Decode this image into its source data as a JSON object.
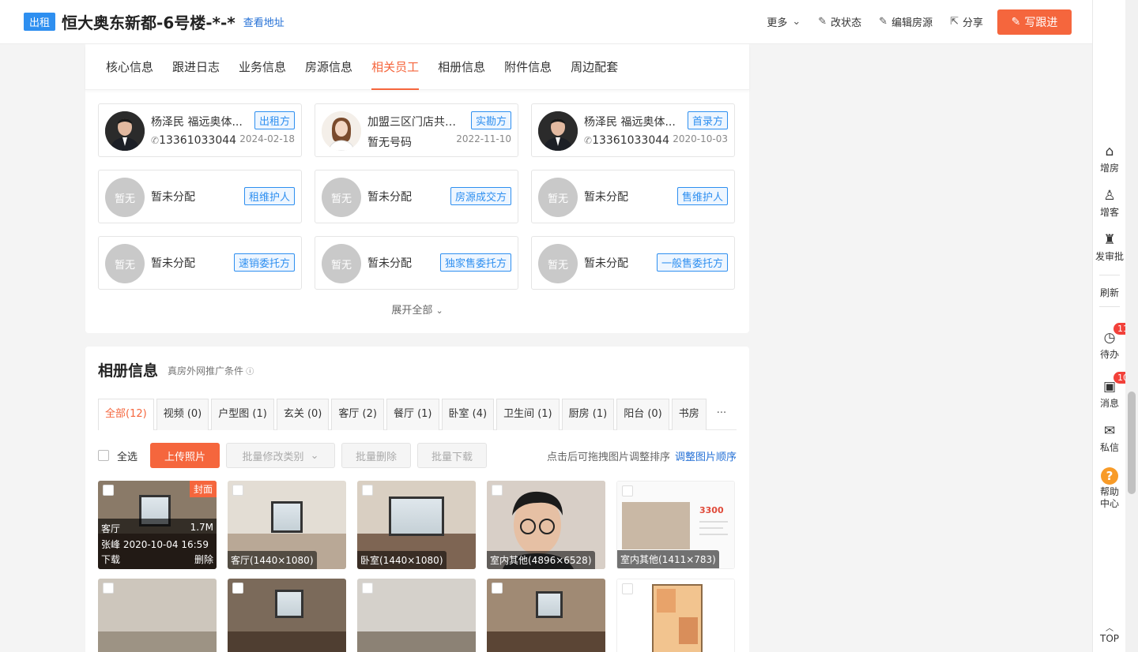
{
  "header": {
    "tag": "出租",
    "title": "恒大奥东新都-6号楼-*-*",
    "address_link": "查看地址",
    "actions": [
      {
        "label": "更多",
        "icon": "chevron-down-icon"
      },
      {
        "label": "改状态",
        "icon": "edit-icon"
      },
      {
        "label": "编辑房源",
        "icon": "edit-icon"
      },
      {
        "label": "分享",
        "icon": "share-icon"
      }
    ],
    "primary_button": "写跟进"
  },
  "tabs": [
    "核心信息",
    "跟进日志",
    "业务信息",
    "房源信息",
    "相关员工",
    "相册信息",
    "附件信息",
    "周边配套"
  ],
  "active_tab": "相关员工",
  "staff": [
    {
      "name": "杨泽民 福远奥体...",
      "phone": "13361033044",
      "date": "2024-02-18",
      "role": "出租方",
      "avatar": "male-photo"
    },
    {
      "name": "加盟三区门店共享...",
      "phone": "暂无号码",
      "date": "2022-11-10",
      "role": "实勘方",
      "avatar": "female-photo"
    },
    {
      "name": "杨泽民 福远奥体...",
      "phone": "13361033044",
      "date": "2020-10-03",
      "role": "首录方",
      "avatar": "male-photo"
    },
    {
      "name": "暂未分配",
      "role": "租维护人",
      "avatar": "暂无"
    },
    {
      "name": "暂未分配",
      "role": "房源成交方",
      "avatar": "暂无"
    },
    {
      "name": "暂未分配",
      "role": "售维护人",
      "avatar": "暂无"
    },
    {
      "name": "暂未分配",
      "role": "速销委托方",
      "avatar": "暂无"
    },
    {
      "name": "暂未分配",
      "role": "独家售委托方",
      "avatar": "暂无"
    },
    {
      "name": "暂未分配",
      "role": "一般售委托方",
      "avatar": "暂无"
    }
  ],
  "expand_label": "展开全部",
  "album": {
    "title": "相册信息",
    "subtitle": "真房外网推广条件",
    "categories": [
      "全部(12)",
      "视频 (0)",
      "户型图 (1)",
      "玄关 (0)",
      "客厅 (2)",
      "餐厅 (1)",
      "卧室 (4)",
      "卫生间 (1)",
      "厨房 (1)",
      "阳台 (0)",
      "书房"
    ],
    "more": "···",
    "select_all": "全选",
    "upload": "上传照片",
    "batch_category": "批量修改类别",
    "batch_delete": "批量删除",
    "batch_download": "批量下载",
    "hint": "点击后可拖拽图片调整排序",
    "hint_link": "调整图片顺序",
    "cover_photo": {
      "badge": "封面",
      "category": "客厅",
      "size": "1.7M",
      "author": "张峰 2020-10-04 16:59",
      "download": "下载",
      "delete": "删除"
    },
    "photos": [
      "客厅(1440×1080)",
      "卧室(1440×1080)",
      "室内其他(4896×6528)",
      "室内其他(1411×783)"
    ]
  },
  "sidebar": [
    {
      "label": "增房",
      "icon": "house-plus-icon"
    },
    {
      "label": "增客",
      "icon": "user-plus-icon"
    },
    {
      "label": "发审批",
      "icon": "stamp-icon"
    },
    {
      "label": "刷新",
      "icon": ""
    },
    {
      "label": "待办",
      "icon": "clock-icon",
      "badge": "11"
    },
    {
      "label": "消息",
      "icon": "message-icon",
      "badge": "10"
    },
    {
      "label": "私信",
      "icon": "mail-icon"
    },
    {
      "label": "帮助中心",
      "icon": "help-icon"
    },
    {
      "label": "TOP",
      "icon": "arrow-up-icon"
    }
  ]
}
